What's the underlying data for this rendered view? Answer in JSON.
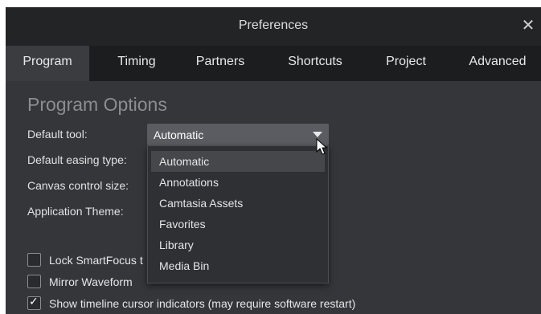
{
  "window": {
    "title": "Preferences",
    "close_glyph": "✕"
  },
  "tabs": [
    {
      "label": "Program",
      "active": true
    },
    {
      "label": "Timing"
    },
    {
      "label": "Partners"
    },
    {
      "label": "Shortcuts"
    },
    {
      "label": "Project"
    },
    {
      "label": "Advanced"
    }
  ],
  "section": {
    "title": "Program Options"
  },
  "labels": {
    "default_tool": "Default tool:",
    "default_easing": "Default easing type:",
    "canvas_control_size": "Canvas control size:",
    "application_theme": "Application Theme:"
  },
  "default_tool_select": {
    "value": "Automatic",
    "options": [
      "Automatic",
      "Annotations",
      "Camtasia Assets",
      "Favorites",
      "Library",
      "Media Bin"
    ],
    "highlighted": "Automatic"
  },
  "checkboxes": [
    {
      "label": "Lock SmartFocus t",
      "checked": false
    },
    {
      "label": "Mirror Waveform",
      "checked": false
    },
    {
      "label": "Show timeline cursor indicators (may require software restart)",
      "checked": true
    }
  ],
  "colors": {
    "titlebar": "#232426",
    "tabbar": "#1c1d1f",
    "panel": "#34363a",
    "select": "#5a5c61",
    "dropdown": "#2f3034"
  },
  "icons": {
    "close": "close-icon",
    "cursor": "mouse-pointer-icon",
    "chevron": "chevron-down-icon",
    "check": "checkmark-icon"
  }
}
